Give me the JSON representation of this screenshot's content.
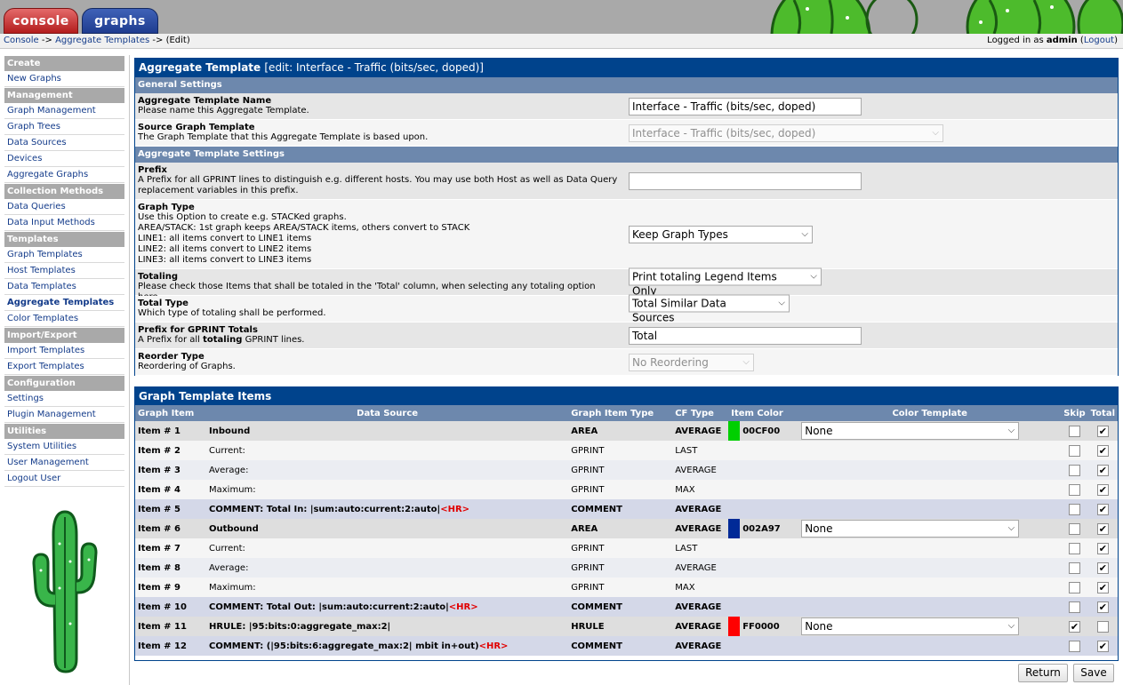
{
  "tabs": {
    "console": "console",
    "graphs": "graphs"
  },
  "breadcrumb": {
    "console": "Console",
    "sep1": " -> ",
    "aggregate_templates": "Aggregate Templates",
    "sep2": " -> ",
    "current": "(Edit)"
  },
  "login": {
    "prefix": "Logged in as ",
    "user": "admin",
    "logout": "Logout"
  },
  "sidebar": {
    "sections": [
      {
        "title": "Create",
        "items": [
          {
            "label": "New Graphs"
          }
        ]
      },
      {
        "title": "Management",
        "items": [
          {
            "label": "Graph Management"
          },
          {
            "label": "Graph Trees"
          },
          {
            "label": "Data Sources"
          },
          {
            "label": "Devices"
          },
          {
            "label": "Aggregate Graphs"
          }
        ]
      },
      {
        "title": "Collection Methods",
        "items": [
          {
            "label": "Data Queries"
          },
          {
            "label": "Data Input Methods"
          }
        ]
      },
      {
        "title": "Templates",
        "items": [
          {
            "label": "Graph Templates"
          },
          {
            "label": "Host Templates"
          },
          {
            "label": "Data Templates"
          },
          {
            "label": "Aggregate Templates",
            "active": true
          },
          {
            "label": "Color Templates"
          }
        ]
      },
      {
        "title": "Import/Export",
        "items": [
          {
            "label": "Import Templates"
          },
          {
            "label": "Export Templates"
          }
        ]
      },
      {
        "title": "Configuration",
        "items": [
          {
            "label": "Settings"
          },
          {
            "label": "Plugin Management"
          }
        ]
      },
      {
        "title": "Utilities",
        "items": [
          {
            "label": "System Utilities"
          },
          {
            "label": "User Management"
          },
          {
            "label": "Logout User"
          }
        ]
      }
    ]
  },
  "template_panel": {
    "title": "Aggregate Template",
    "subtitle": "[edit: Interface - Traffic (bits/sec, doped)]",
    "general_settings": "General Settings",
    "name_label": "Aggregate Template Name",
    "name_desc": "Please name this Aggregate Template.",
    "name_value": "Interface - Traffic (bits/sec, doped)",
    "source_label": "Source Graph Template",
    "source_desc": "The Graph Template that this Aggregate Template is based upon.",
    "source_value": "Interface - Traffic (bits/sec, doped)",
    "aggregate_settings": "Aggregate Template Settings",
    "prefix_label": "Prefix",
    "prefix_desc": "A Prefix for all GPRINT lines to distinguish e.g. different hosts. You may use both Host as well as Data Query replacement variables in this prefix.",
    "prefix_value": "",
    "graph_type_label": "Graph Type",
    "graph_type_desc": [
      "Use this Option to create e.g. STACKed graphs.",
      "AREA/STACK: 1st graph keeps AREA/STACK items, others convert to STACK",
      "LINE1: all items convert to LINE1 items",
      "LINE2: all items convert to LINE2 items",
      "LINE3: all items convert to LINE3 items"
    ],
    "graph_type_value": "Keep Graph Types",
    "totaling_label": "Totaling",
    "totaling_desc": "Please check those Items that shall be totaled in the 'Total' column, when selecting any totaling option here.",
    "totaling_value": "Print totaling Legend Items Only",
    "total_type_label": "Total Type",
    "total_type_desc": "Which type of totaling shall be performed.",
    "total_type_value": "Total Similar Data Sources",
    "gprint_prefix_label": "Prefix for GPRINT Totals",
    "gprint_prefix_desc_a": "A Prefix for all ",
    "gprint_prefix_desc_b": "totaling",
    "gprint_prefix_desc_c": " GPRINT lines.",
    "gprint_prefix_value": "Total",
    "reorder_label": "Reorder Type",
    "reorder_desc": "Reordering of Graphs.",
    "reorder_value": "No Reordering"
  },
  "items_panel": {
    "title": "Graph Template Items",
    "headers": {
      "graph_item": "Graph Item",
      "data_source": "Data Source",
      "graph_item_type": "Graph Item Type",
      "cf_type": "CF Type",
      "item_color": "Item Color",
      "color_template": "Color Template",
      "skip": "Skip",
      "total": "Total"
    },
    "rows": [
      {
        "item": "Item # 1",
        "source": "Inbound",
        "hr": "",
        "type": "AREA",
        "cf": "AVERAGE",
        "color": "00CF00",
        "color_hex": "#00CF00",
        "template": "None",
        "skip": false,
        "total": true,
        "style": "hl"
      },
      {
        "item": "Item # 2",
        "source": "Current:",
        "hr": "",
        "type": "GPRINT",
        "cf": "LAST",
        "color": "",
        "color_hex": "",
        "template": "",
        "skip": false,
        "total": true,
        "style": "n1"
      },
      {
        "item": "Item # 3",
        "source": "Average:",
        "hr": "",
        "type": "GPRINT",
        "cf": "AVERAGE",
        "color": "",
        "color_hex": "",
        "template": "",
        "skip": false,
        "total": true,
        "style": "n2"
      },
      {
        "item": "Item # 4",
        "source": "Maximum:",
        "hr": "",
        "type": "GPRINT",
        "cf": "MAX",
        "color": "",
        "color_hex": "",
        "template": "",
        "skip": false,
        "total": true,
        "style": "n1"
      },
      {
        "item": "Item # 5",
        "source": "COMMENT: Total In: |sum:auto:current:2:auto|",
        "hr": "<HR>",
        "type": "COMMENT",
        "cf": "AVERAGE",
        "color": "",
        "color_hex": "",
        "template": "",
        "skip": false,
        "total": true,
        "style": "cm"
      },
      {
        "item": "Item # 6",
        "source": "Outbound",
        "hr": "",
        "type": "AREA",
        "cf": "AVERAGE",
        "color": "002A97",
        "color_hex": "#002A97",
        "template": "None",
        "skip": false,
        "total": true,
        "style": "hl"
      },
      {
        "item": "Item # 7",
        "source": "Current:",
        "hr": "",
        "type": "GPRINT",
        "cf": "LAST",
        "color": "",
        "color_hex": "",
        "template": "",
        "skip": false,
        "total": true,
        "style": "n1"
      },
      {
        "item": "Item # 8",
        "source": "Average:",
        "hr": "",
        "type": "GPRINT",
        "cf": "AVERAGE",
        "color": "",
        "color_hex": "",
        "template": "",
        "skip": false,
        "total": true,
        "style": "n2"
      },
      {
        "item": "Item # 9",
        "source": "Maximum:",
        "hr": "",
        "type": "GPRINT",
        "cf": "MAX",
        "color": "",
        "color_hex": "",
        "template": "",
        "skip": false,
        "total": true,
        "style": "n1"
      },
      {
        "item": "Item # 10",
        "source": "COMMENT: Total Out: |sum:auto:current:2:auto|",
        "hr": "<HR>",
        "type": "COMMENT",
        "cf": "AVERAGE",
        "color": "",
        "color_hex": "",
        "template": "",
        "skip": false,
        "total": true,
        "style": "cm"
      },
      {
        "item": "Item # 11",
        "source": "HRULE: |95:bits:0:aggregate_max:2|",
        "hr": "",
        "type": "HRULE",
        "cf": "AVERAGE",
        "color": "FF0000",
        "color_hex": "#FF0000",
        "template": "None",
        "skip": true,
        "total": false,
        "style": "hl"
      },
      {
        "item": "Item # 12",
        "source": "COMMENT: (|95:bits:6:aggregate_max:2| mbit in+out)",
        "hr": "<HR>",
        "type": "COMMENT",
        "cf": "AVERAGE",
        "color": "",
        "color_hex": "",
        "template": "",
        "skip": false,
        "total": true,
        "style": "cm"
      }
    ]
  },
  "buttons": {
    "return": "Return",
    "save": "Save"
  },
  "icons": {
    "select_arrow": "chevron-down-icon",
    "checkbox_checked": "check-icon",
    "logo": "cactus-logo-icon"
  }
}
